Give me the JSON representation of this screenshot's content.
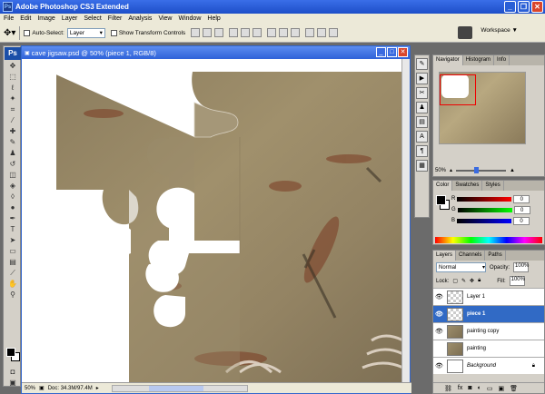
{
  "app": {
    "title": "Adobe Photoshop CS3 Extended",
    "icon": "Ps"
  },
  "window_buttons": [
    "_",
    "❐",
    "✕"
  ],
  "menu": [
    "File",
    "Edit",
    "Image",
    "Layer",
    "Select",
    "Filter",
    "Analysis",
    "View",
    "Window",
    "Help"
  ],
  "options": {
    "auto_select_label": "Auto-Select:",
    "auto_select_value": "Layer",
    "show_transform_label": "Show Transform Controls",
    "workspace_label": "Workspace ▼"
  },
  "document": {
    "title": "cave jigsaw.psd @ 50% (piece 1, RGB/8)",
    "zoom": "50%",
    "doc_size": "Doc: 34.3M/97.4M"
  },
  "navigator": {
    "tabs": [
      "Navigator",
      "Histogram",
      "Info"
    ],
    "zoom": "50%"
  },
  "color_panel": {
    "tabs": [
      "Color",
      "Swatches",
      "Styles"
    ],
    "channels": [
      {
        "label": "R",
        "value": "0"
      },
      {
        "label": "G",
        "value": "0"
      },
      {
        "label": "B",
        "value": "0"
      }
    ]
  },
  "layers_panel": {
    "tabs": [
      "Layers",
      "Channels",
      "Paths"
    ],
    "blend_mode": "Normal",
    "opacity_label": "Opacity:",
    "opacity": "100%",
    "lock_label": "Lock:",
    "fill_label": "Fill:",
    "fill": "100%",
    "layers": [
      {
        "name": "Layer 1",
        "thumb": "checker",
        "selected": false,
        "visible": true
      },
      {
        "name": "piece 1",
        "thumb": "checker",
        "selected": true,
        "visible": true
      },
      {
        "name": "painting copy",
        "thumb": "photo",
        "selected": false,
        "visible": true
      },
      {
        "name": "painting",
        "thumb": "photo",
        "selected": false,
        "visible": false
      },
      {
        "name": "Background",
        "thumb": "white",
        "selected": false,
        "visible": true
      }
    ]
  }
}
